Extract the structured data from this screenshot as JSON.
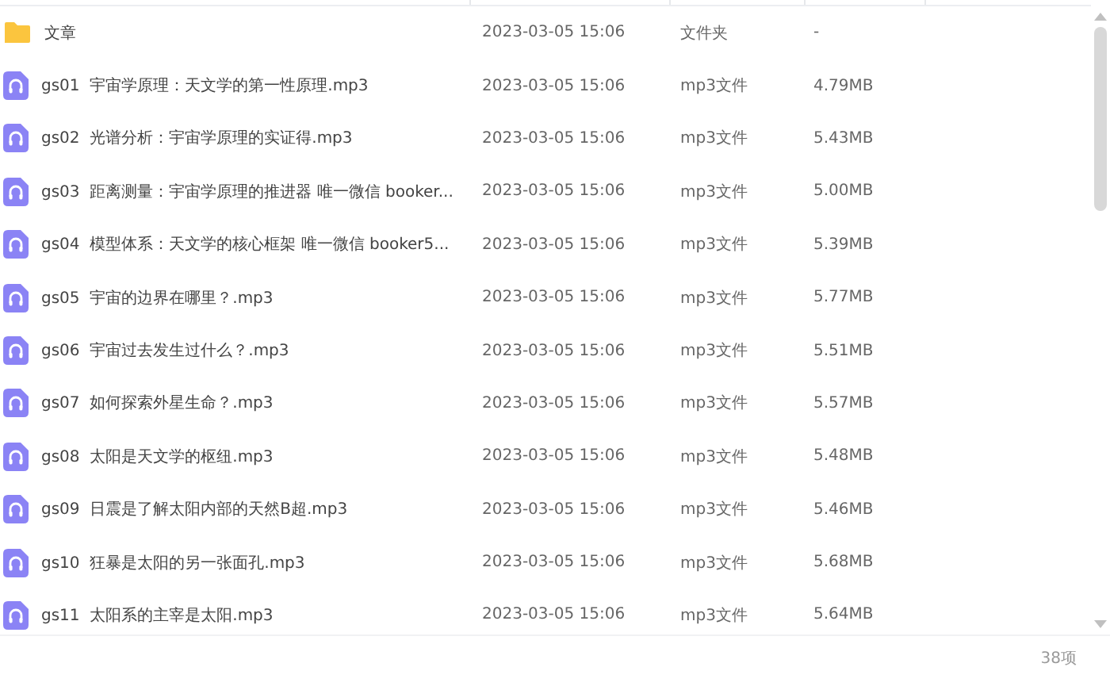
{
  "files": [
    {
      "kind": "folder",
      "name": "文章",
      "modified": "2023-03-05 15:06",
      "type": "文件夹",
      "size": "-"
    },
    {
      "kind": "audio",
      "name": "gs01  宇宙学原理：天文学的第一性原理.mp3",
      "modified": "2023-03-05 15:06",
      "type": "mp3文件",
      "size": "4.79MB"
    },
    {
      "kind": "audio",
      "name": "gs02  光谱分析：宇宙学原理的实证得.mp3",
      "modified": "2023-03-05 15:06",
      "type": "mp3文件",
      "size": "5.43MB"
    },
    {
      "kind": "audio",
      "name": "gs03  距离测量：宇宙学原理的推进器 唯一微信 booker...",
      "modified": "2023-03-05 15:06",
      "type": "mp3文件",
      "size": "5.00MB"
    },
    {
      "kind": "audio",
      "name": "gs04  模型体系：天文学的核心框架 唯一微信 booker5...",
      "modified": "2023-03-05 15:06",
      "type": "mp3文件",
      "size": "5.39MB"
    },
    {
      "kind": "audio",
      "name": "gs05  宇宙的边界在哪里？.mp3",
      "modified": "2023-03-05 15:06",
      "type": "mp3文件",
      "size": "5.77MB"
    },
    {
      "kind": "audio",
      "name": "gs06  宇宙过去发生过什么？.mp3",
      "modified": "2023-03-05 15:06",
      "type": "mp3文件",
      "size": "5.51MB"
    },
    {
      "kind": "audio",
      "name": "gs07  如何探索外星生命？.mp3",
      "modified": "2023-03-05 15:06",
      "type": "mp3文件",
      "size": "5.57MB"
    },
    {
      "kind": "audio",
      "name": "gs08  太阳是天文学的枢纽.mp3",
      "modified": "2023-03-05 15:06",
      "type": "mp3文件",
      "size": "5.48MB"
    },
    {
      "kind": "audio",
      "name": "gs09  日震是了解太阳内部的天然B超.mp3",
      "modified": "2023-03-05 15:06",
      "type": "mp3文件",
      "size": "5.46MB"
    },
    {
      "kind": "audio",
      "name": "gs10  狂暴是太阳的另一张面孔.mp3",
      "modified": "2023-03-05 15:06",
      "type": "mp3文件",
      "size": "5.68MB"
    },
    {
      "kind": "audio",
      "name": "gs11  太阳系的主宰是太阳.mp3",
      "modified": "2023-03-05 15:06",
      "type": "mp3文件",
      "size": "5.64MB"
    }
  ],
  "status_bar": {
    "count": "38项"
  }
}
